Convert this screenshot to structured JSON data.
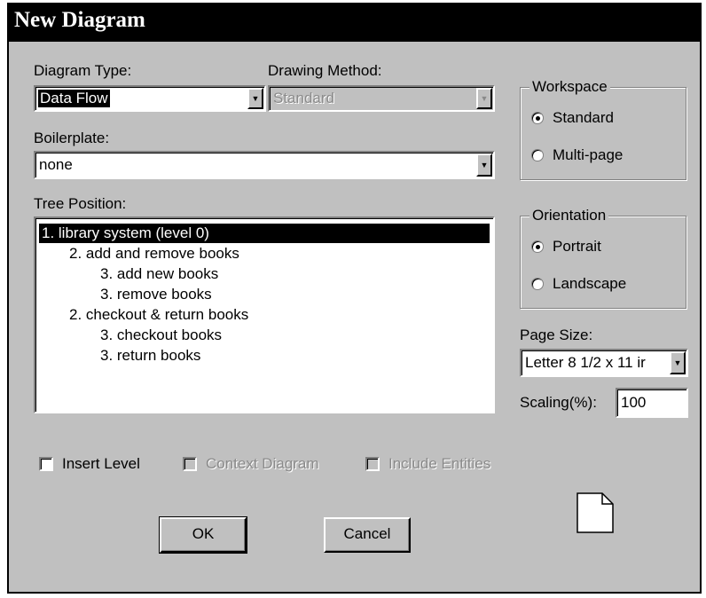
{
  "dialog": {
    "title": "New Diagram",
    "diagram_type": {
      "label": "Diagram Type:",
      "value": "Data Flow"
    },
    "drawing_method": {
      "label": "Drawing Method:",
      "value": "Standard"
    },
    "boilerplate": {
      "label": "Boilerplate:",
      "value": "none"
    },
    "tree_position": {
      "label": "Tree Position:",
      "items": [
        "1. library system (level 0)",
        "2. add and remove books",
        "3. add new books",
        "3. remove books",
        "2. checkout & return books",
        "3. checkout books",
        "3. return books"
      ]
    },
    "workspace": {
      "label": "Workspace",
      "options": [
        "Standard",
        "Multi-page"
      ],
      "selected": "Standard"
    },
    "orientation": {
      "label": "Orientation",
      "options": [
        "Portrait",
        "Landscape"
      ],
      "selected": "Portrait"
    },
    "page_size": {
      "label": "Page Size:",
      "value": "Letter 8 1/2 x 11 ir"
    },
    "scaling": {
      "label": "Scaling(%):",
      "value": "100"
    },
    "checkboxes": {
      "insert_level": "Insert Level",
      "context_diagram": "Context Diagram",
      "include_entities": "Include Entities"
    },
    "buttons": {
      "ok": "OK",
      "cancel": "Cancel"
    },
    "icons": {
      "page_preview": "page-icon",
      "dropdown": "chevron-down-icon"
    }
  }
}
